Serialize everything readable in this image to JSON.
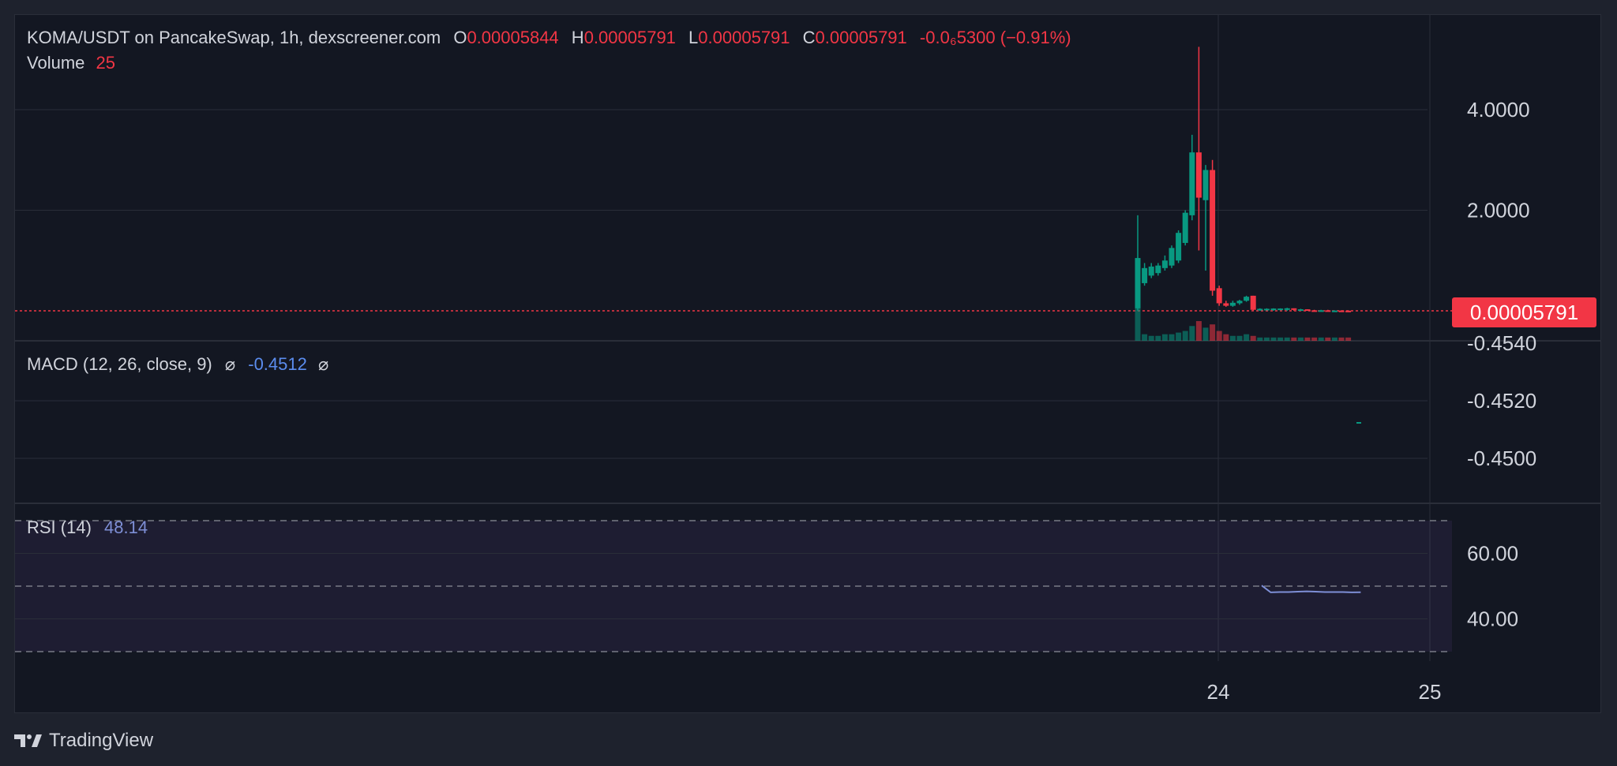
{
  "legend": {
    "title": "KOMA/USDT on PancakeSwap, 1h, dexscreener.com",
    "o_label": "O",
    "o_value": "0.00005844",
    "h_label": "H",
    "h_value": "0.00005791",
    "l_label": "L",
    "l_value": "0.00005791",
    "c_label": "C",
    "c_value": "0.00005791",
    "change": "-0.0₆5300 (−0.91%)",
    "volume_label": "Volume",
    "volume_value": "25"
  },
  "macd_legend": {
    "label": "MACD (12, 26, close, 9)",
    "symbol1": "⌀",
    "value": "-0.4512",
    "symbol2": "⌀"
  },
  "rsi_legend": {
    "label": "RSI (14)",
    "value": "48.14"
  },
  "price_tag": "0.00005791",
  "brand": "TradingView",
  "colors": {
    "up": "#089981",
    "down": "#f23645",
    "rsi_line": "#7e8fd6",
    "background": "#131722"
  },
  "chart_data": [
    {
      "type": "candlestick",
      "title": "KOMA/USDT on PancakeSwap, 1h, dexscreener.com",
      "y_ticks": [
        "4.0000",
        "2.0000"
      ],
      "y_tick_values": [
        4.0,
        2.0
      ],
      "x_ticks": [
        "24",
        "25"
      ],
      "last_price": "0.00005791",
      "ohlc": [
        {
          "o": 0.05,
          "h": 1.9,
          "l": 0.0,
          "c": 1.05
        },
        {
          "o": 0.55,
          "h": 0.95,
          "l": 0.5,
          "c": 0.85
        },
        {
          "o": 0.7,
          "h": 0.95,
          "l": 0.65,
          "c": 0.88
        },
        {
          "o": 0.75,
          "h": 0.95,
          "l": 0.7,
          "c": 0.9
        },
        {
          "o": 0.85,
          "h": 1.1,
          "l": 0.8,
          "c": 1.0
        },
        {
          "o": 0.9,
          "h": 1.3,
          "l": 0.85,
          "c": 1.25
        },
        {
          "o": 1.0,
          "h": 1.6,
          "l": 0.95,
          "c": 1.55
        },
        {
          "o": 1.35,
          "h": 2.0,
          "l": 1.3,
          "c": 1.95
        },
        {
          "o": 1.9,
          "h": 3.5,
          "l": 1.8,
          "c": 3.15
        },
        {
          "o": 3.15,
          "h": 5.25,
          "l": 1.2,
          "c": 2.25
        },
        {
          "o": 2.2,
          "h": 2.9,
          "l": 0.8,
          "c": 2.8
        },
        {
          "o": 2.8,
          "h": 3.0,
          "l": 0.3,
          "c": 0.4
        },
        {
          "o": 0.45,
          "h": 0.5,
          "l": 0.1,
          "c": 0.15
        },
        {
          "o": 0.15,
          "h": 0.2,
          "l": 0.08,
          "c": 0.1
        },
        {
          "o": 0.1,
          "h": 0.2,
          "l": 0.08,
          "c": 0.16
        },
        {
          "o": 0.15,
          "h": 0.22,
          "l": 0.12,
          "c": 0.2
        },
        {
          "o": 0.2,
          "h": 0.3,
          "l": 0.18,
          "c": 0.28
        },
        {
          "o": 0.3,
          "h": 0.3,
          "l": 0.0,
          "c": 0.02
        },
        {
          "o": 0.02,
          "h": 0.05,
          "l": 0.0,
          "c": 0.04
        },
        {
          "o": 0.03,
          "h": 0.05,
          "l": 0.01,
          "c": 0.04
        },
        {
          "o": 0.03,
          "h": 0.05,
          "l": 0.0,
          "c": 0.045
        },
        {
          "o": 0.04,
          "h": 0.05,
          "l": 0.01,
          "c": 0.045
        },
        {
          "o": 0.04,
          "h": 0.06,
          "l": 0.0,
          "c": 0.05
        },
        {
          "o": 0.05,
          "h": 0.05,
          "l": 0.0,
          "c": 0.02
        },
        {
          "o": 0.02,
          "h": 0.04,
          "l": 0.0,
          "c": 0.03
        },
        {
          "o": 0.03,
          "h": 0.03,
          "l": 0.0,
          "c": 0.01
        },
        {
          "o": 0.01,
          "h": 0.02,
          "l": 0.0,
          "c": 0.005
        },
        {
          "o": 0.005,
          "h": 0.02,
          "l": 0.0,
          "c": 0.01
        },
        {
          "o": 0.01,
          "h": 0.02,
          "l": 0.0,
          "c": 0.005
        },
        {
          "o": 0.005,
          "h": 0.01,
          "l": 0.0,
          "c": 0.005
        },
        {
          "o": 0.005,
          "h": 0.01,
          "l": 0.0,
          "c": 0.003
        },
        {
          "o": 0.003,
          "h": 0.01,
          "l": 0.0,
          "c": 0.002
        }
      ],
      "volume": [
        25,
        4,
        3,
        3,
        4,
        4,
        5,
        6,
        9,
        12,
        8,
        10,
        6,
        4,
        3,
        3,
        4,
        3,
        2,
        2,
        2,
        2,
        2,
        2,
        2,
        2,
        2,
        2,
        2,
        2,
        2,
        2
      ]
    },
    {
      "type": "line",
      "title": "MACD (12, 26, close, 9)",
      "y_ticks": [
        "-0.4540",
        "-0.4520",
        "-0.4500"
      ],
      "y_tick_values": [
        -0.454,
        -0.452,
        -0.45
      ],
      "last_value": -0.4512
    },
    {
      "type": "line",
      "title": "RSI (14)",
      "y_ticks": [
        "60.00",
        "40.00"
      ],
      "y_tick_values": [
        60,
        40
      ],
      "bands": [
        70,
        50,
        30
      ],
      "values": [
        50.2,
        48.1,
        48.2,
        48.2,
        48.3,
        48.4,
        48.3,
        48.2,
        48.2,
        48.2,
        48.1,
        48.14
      ]
    }
  ]
}
